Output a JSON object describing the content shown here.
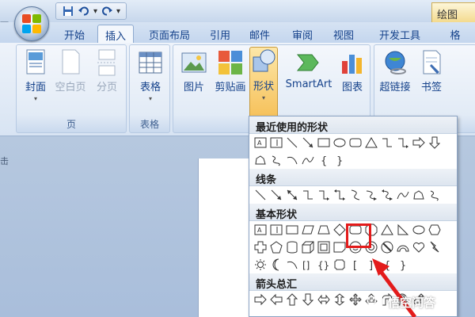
{
  "window": {
    "context_tab_label": "绘图",
    "left_edge_text": "一"
  },
  "quick_access": {
    "icons": [
      "save-icon",
      "undo-icon",
      "redo-icon",
      "customize-icon"
    ]
  },
  "tabs": [
    {
      "label": "开始",
      "active": false
    },
    {
      "label": "插入",
      "active": true
    },
    {
      "label": "页面布局",
      "active": false
    },
    {
      "label": "引用",
      "active": false
    },
    {
      "label": "邮件",
      "active": false
    },
    {
      "label": "审阅",
      "active": false
    },
    {
      "label": "视图",
      "active": false
    },
    {
      "label": "开发工具",
      "active": false
    },
    {
      "label": "格",
      "active": false
    }
  ],
  "ribbon": {
    "groups": {
      "pages": {
        "label": "页",
        "buttons": {
          "cover": "封面",
          "blank_page": "空白页",
          "page_break": "分页"
        }
      },
      "tables": {
        "label": "表格",
        "buttons": {
          "table": "表格"
        }
      },
      "illustrations": {
        "buttons": {
          "picture": "图片",
          "clipart": "剪贴画",
          "shapes": "形状",
          "smartart": "SmartArt",
          "chart": "图表"
        }
      },
      "links": {
        "buttons": {
          "hyperlink": "超链接",
          "bookmark": "书签"
        }
      }
    }
  },
  "shapes_menu": {
    "sections": {
      "recent": "最近使用的形状",
      "lines": "线条",
      "basic": "基本形状",
      "arrows": "箭头总汇"
    },
    "highlighted_shape": "rounded-rectangle"
  },
  "watermark": {
    "text": "悟空问答"
  },
  "left_marker": "击",
  "colors": {
    "highlight": "#e31b1b",
    "ribbon_text": "#15428b",
    "pressed": "#f6c15a"
  }
}
